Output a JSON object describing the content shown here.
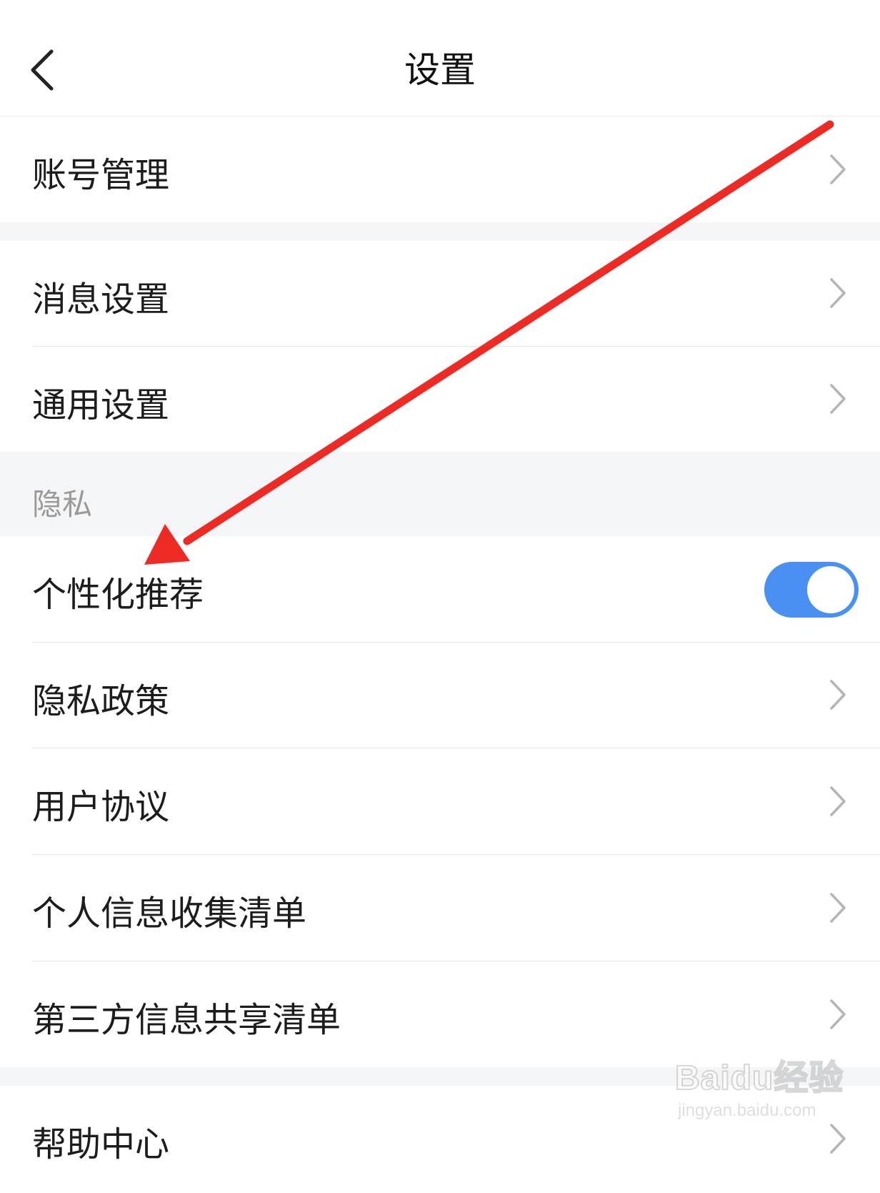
{
  "navbar": {
    "title": "设置"
  },
  "sections": {
    "privacy_header": "隐私"
  },
  "items": {
    "account": "账号管理",
    "message": "消息设置",
    "general": "通用设置",
    "personalized": "个性化推荐",
    "privacy_policy": "隐私政策",
    "user_agreement": "用户协议",
    "personal_info_list": "个人信息收集清单",
    "third_party_list": "第三方信息共享清单",
    "help_center": "帮助中心"
  },
  "toggles": {
    "personalized_recommendation": "on"
  },
  "colors": {
    "toggle_on": "#4a90f2",
    "arrow_annotation": "#ee2a24",
    "section_gap": "#f4f5f7"
  },
  "watermark": {
    "brand": "Baidu经验",
    "url": "jingyan.baidu.com"
  }
}
